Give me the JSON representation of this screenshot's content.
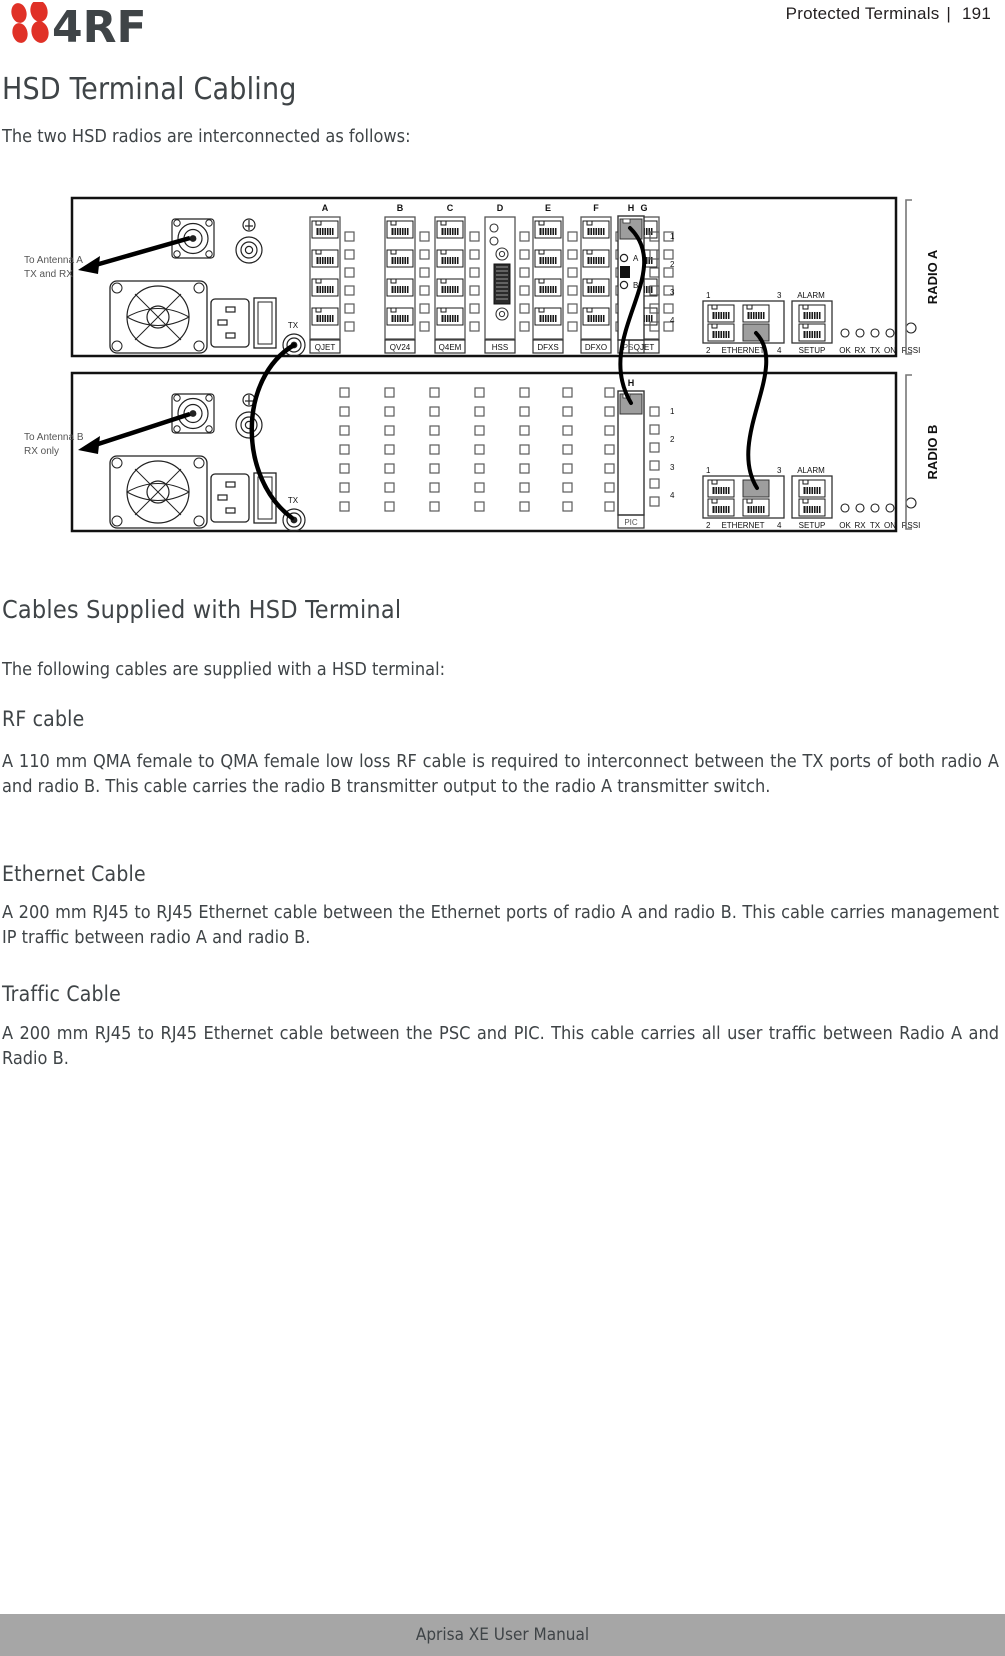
{
  "header": {
    "logo_text": "4RF",
    "logo_icon": "four-dots-logo",
    "breadcrumb": "Protected Terminals",
    "separator": "|",
    "page_number": "191"
  },
  "page": {
    "title": "HSD Terminal Cabling",
    "intro": "The two HSD radios are interconnected as follows:"
  },
  "sections": {
    "cables": {
      "heading": "Cables Supplied with HSD Terminal",
      "lead": "The following cables are supplied with a HSD terminal:"
    },
    "rf": {
      "heading": "RF cable",
      "body": "A 110 mm QMA female to QMA female low loss RF cable is required to interconnect between the TX ports of both radio A and radio B. This cable carries the radio B transmitter output to the radio A transmitter switch."
    },
    "ethernet": {
      "heading": "Ethernet Cable",
      "body": "A 200 mm RJ45 to RJ45 Ethernet cable between the Ethernet ports of radio A and radio B. This cable carries management IP traffic between radio A and radio B."
    },
    "traffic": {
      "heading": "Traffic Cable",
      "body": "A 200 mm RJ45 to RJ45 Ethernet cable between the PSC and PIC. This cable carries all user traffic between Radio A and Radio B."
    }
  },
  "diagram": {
    "caption_radio_a": "RADIO A",
    "caption_radio_b": "RADIO B",
    "antenna_a_label_line1": "To Antenna A",
    "antenna_a_label_line2": "TX and RX",
    "antenna_b_label_line1": "To Antenna B",
    "antenna_b_label_line2": "RX only",
    "tx_label": "TX",
    "radio_a_slots": [
      {
        "letter": "A",
        "card": "QJET"
      },
      {
        "letter": "B",
        "card": "QV24"
      },
      {
        "letter": "C",
        "card": "Q4EM"
      },
      {
        "letter": "D",
        "card": "HSS"
      },
      {
        "letter": "E",
        "card": "DFXS"
      },
      {
        "letter": "F",
        "card": "DFXO"
      },
      {
        "letter": "G",
        "card": "QJET"
      },
      {
        "letter": "H",
        "card": "PSC"
      }
    ],
    "radio_b_slots": [
      {
        "letter": "",
        "card": ""
      },
      {
        "letter": "",
        "card": ""
      },
      {
        "letter": "",
        "card": ""
      },
      {
        "letter": "",
        "card": ""
      },
      {
        "letter": "",
        "card": ""
      },
      {
        "letter": "",
        "card": ""
      },
      {
        "letter": "",
        "card": ""
      },
      {
        "letter": "H",
        "card": "PIC"
      }
    ],
    "psc_led_a": "A",
    "psc_led_b": "B",
    "port_numbers": [
      "1",
      "2",
      "3",
      "4"
    ],
    "ethernet_block_label": "ETHERNET",
    "ethernet_port_tl": "1",
    "ethernet_port_tr": "3",
    "ethernet_port_bl": "2",
    "ethernet_port_br": "4",
    "alarm_label": "ALARM",
    "setup_label": "SETUP",
    "leds": [
      "OK",
      "RX",
      "TX",
      "ON",
      "RSSI"
    ]
  },
  "footer": {
    "text": "Aprisa XE User Manual"
  },
  "colors": {
    "brand_red": "#e03127",
    "brand_dark": "#3f4447",
    "footer_gray": "#a6a6a6",
    "text": "#3f4447"
  }
}
